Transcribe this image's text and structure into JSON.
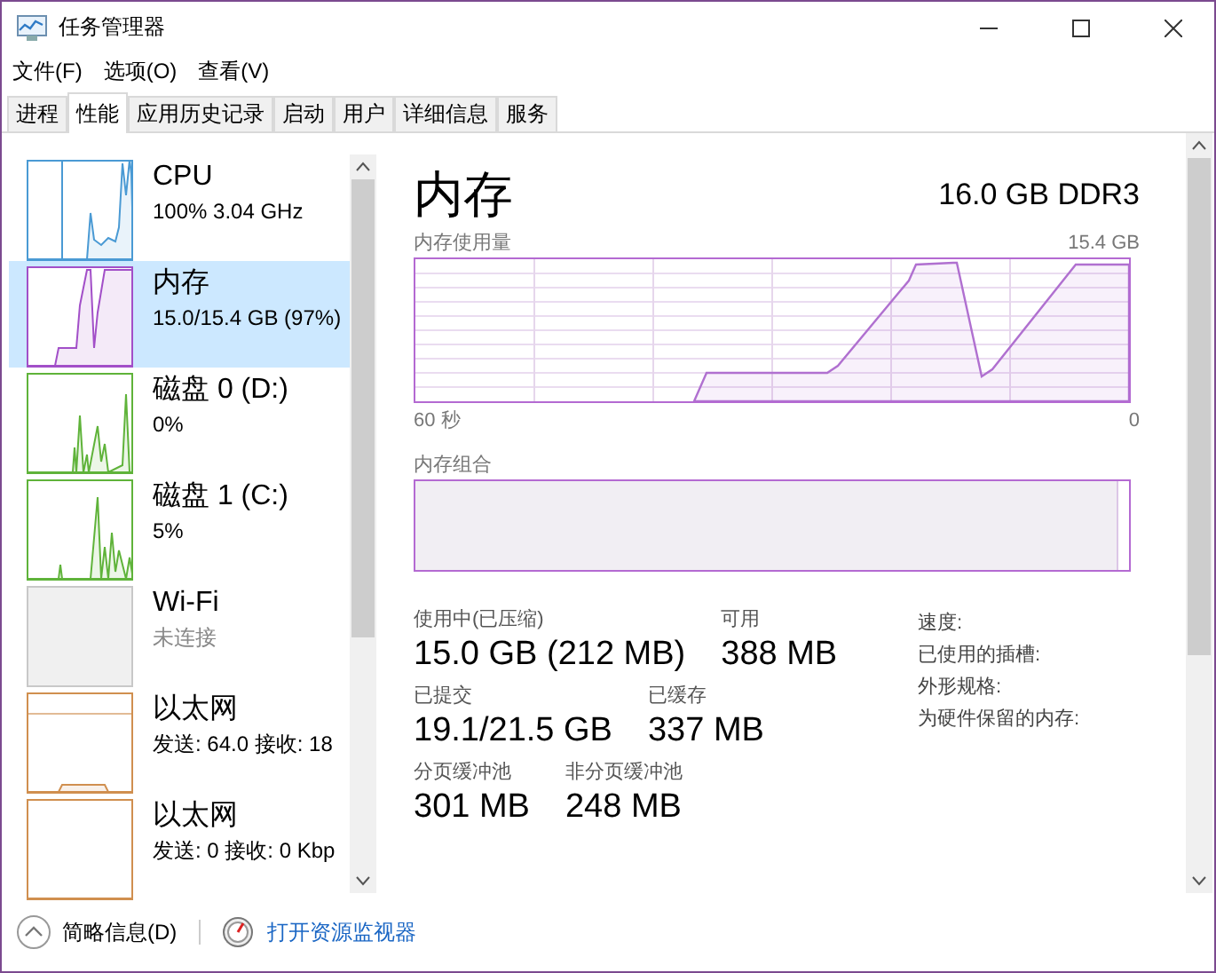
{
  "window": {
    "title": "任务管理器"
  },
  "menu": [
    "文件(F)",
    "选项(O)",
    "查看(V)"
  ],
  "tabs": [
    {
      "label": "进程",
      "selected": false
    },
    {
      "label": "性能",
      "selected": true
    },
    {
      "label": "应用历史记录",
      "selected": false
    },
    {
      "label": "启动",
      "selected": false
    },
    {
      "label": "用户",
      "selected": false
    },
    {
      "label": "详细信息",
      "selected": false
    },
    {
      "label": "服务",
      "selected": false
    }
  ],
  "sidebar": {
    "items": [
      {
        "kind": "cpu",
        "title": "CPU",
        "subtitle": "100% 3.04 GHz",
        "color": "#4a9ad4",
        "selected": false,
        "dimmed": false
      },
      {
        "kind": "memory",
        "title": "内存",
        "subtitle": "15.0/15.4 GB (97%)",
        "color": "#a24fc8",
        "selected": true,
        "dimmed": false
      },
      {
        "kind": "disk",
        "title": "磁盘 0 (D:)",
        "subtitle": "0%",
        "color": "#5fb33a",
        "selected": false,
        "dimmed": false
      },
      {
        "kind": "disk2",
        "title": "磁盘 1 (C:)",
        "subtitle": "5%",
        "color": "#5fb33a",
        "selected": false,
        "dimmed": false
      },
      {
        "kind": "wifi",
        "title": "Wi-Fi",
        "subtitle": "未连接",
        "color": "#c8c8c8",
        "selected": false,
        "dimmed": true
      },
      {
        "kind": "ethernet",
        "title": "以太网",
        "subtitle": "发送: 64.0 接收: 18",
        "color": "#d08f4f",
        "selected": false,
        "dimmed": false
      },
      {
        "kind": "ethernet2",
        "title": "以太网",
        "subtitle": "发送: 0 接收: 0 Kbp",
        "color": "#d08f4f",
        "selected": false,
        "dimmed": false
      }
    ]
  },
  "detail": {
    "title": "内存",
    "spec": "16.0 GB DDR3",
    "usage_label": "内存使用量",
    "usage_max": "15.4 GB",
    "time_start": "60 秒",
    "time_end": "0",
    "composition_label": "内存组合",
    "stats": [
      {
        "label": "使用中(已压缩)",
        "value": "15.0 GB (212 MB)"
      },
      {
        "label": "可用",
        "value": "388 MB"
      },
      {
        "label": "已提交",
        "value": "19.1/21.5 GB"
      },
      {
        "label": "已缓存",
        "value": "337 MB"
      },
      {
        "label": "分页缓冲池",
        "value": "301 MB"
      },
      {
        "label": "非分页缓冲池",
        "value": "248 MB"
      }
    ],
    "properties": [
      "速度:",
      "已使用的插槽:",
      "外形规格:",
      "为硬件保留的内存:"
    ]
  },
  "footer": {
    "summary": "简略信息(D)",
    "monitor_link": "打开资源监视器"
  }
}
